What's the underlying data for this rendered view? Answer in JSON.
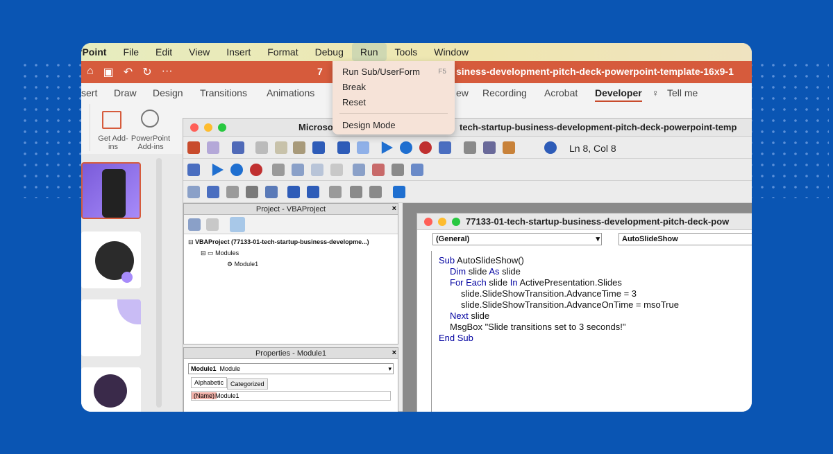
{
  "menubar": {
    "app_name": "rPoint",
    "items": [
      "File",
      "Edit",
      "View",
      "Insert",
      "Format",
      "Debug",
      "Run",
      "Tools",
      "Window"
    ]
  },
  "ppt": {
    "doc_title": "7",
    "doc_title_tail": "siness-development-pitch-deck-powerpoint-template-16x9-1"
  },
  "ribbon": {
    "tabs": [
      "sert",
      "Draw",
      "Design",
      "Transitions",
      "Animations",
      "ew",
      "Recording",
      "Acrobat",
      "Developer",
      "Tell me"
    ],
    "get_addins": "Get Add-ins",
    "ppt_addins": "PowerPoint Add-ins"
  },
  "run_menu": {
    "items": [
      {
        "label": "Run Sub/UserForm",
        "shortcut": "F5"
      },
      {
        "label": "Break"
      },
      {
        "label": "Reset"
      },
      {
        "label": "Design Mode"
      }
    ]
  },
  "vba": {
    "title_left": "Microso",
    "title_right": "tech-startup-business-development-pitch-deck-powerpoint-temp",
    "cursor_pos": "Ln 8, Col 8"
  },
  "project": {
    "header": "Project - VBAProject",
    "root": "VBAProject (77133-01-tech-startup-business-developme...)",
    "modules": "Modules",
    "module1": "Module1"
  },
  "properties": {
    "header": "Properties - Module1",
    "object": "Module1",
    "object_type": "Module",
    "tab_alpha": "Alphabetic",
    "tab_cat": "Categorized",
    "prop_name": "(Name)",
    "prop_value": "Module1"
  },
  "code_window": {
    "title": "77133-01-tech-startup-business-development-pitch-deck-pow",
    "combo_left": "(General)",
    "combo_right": "AutoSlideShow",
    "lines": [
      [
        "Sub",
        " AutoSlideShow()"
      ],
      [
        "Dim",
        " slide ",
        "As",
        " slide"
      ],
      [
        "For Each",
        " slide ",
        "In",
        " ActivePresentation.Slides"
      ],
      [
        "",
        "slide.SlideShowTransition.AdvanceTime = 3"
      ],
      [
        "",
        "slide.SlideShowTransition.AdvanceOnTime = msoTrue"
      ],
      [
        "Next",
        " slide"
      ],
      [
        "",
        "MsgBox \"Slide transitions set to 3 seconds!\""
      ],
      [
        "End Sub",
        ""
      ]
    ]
  },
  "colors": {
    "background": "#0a55b3",
    "ppt_accent": "#d65b3c"
  }
}
